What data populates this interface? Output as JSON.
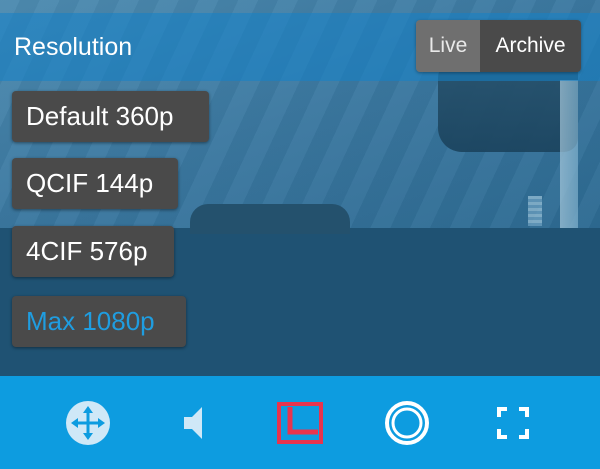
{
  "header": {
    "title": "Resolution",
    "mode_toggle": {
      "live_label": "Live",
      "archive_label": "Archive",
      "selected": "Archive"
    }
  },
  "resolutions": [
    {
      "label": "Default 360p",
      "selected": false
    },
    {
      "label": "QCIF 144p",
      "selected": false
    },
    {
      "label": "4CIF 576p",
      "selected": false
    },
    {
      "label": "Max 1080p",
      "selected": true
    }
  ],
  "toolbar": {
    "items": [
      {
        "icon": "ptz-move-icon",
        "color": "#cfe8f7"
      },
      {
        "icon": "speaker-icon",
        "color": "#cfe8f7"
      },
      {
        "icon": "layout-icon",
        "color": "#e8344e"
      },
      {
        "icon": "fisheye-icon",
        "color": "#ffffff"
      },
      {
        "icon": "fullscreen-icon",
        "color": "#ffffff"
      }
    ]
  },
  "colors": {
    "accent": "#1f9de0",
    "toolbar_bg": "#0d9ce0",
    "menu_bg": "#4a4a4a",
    "active_tool": "#e8344e"
  }
}
